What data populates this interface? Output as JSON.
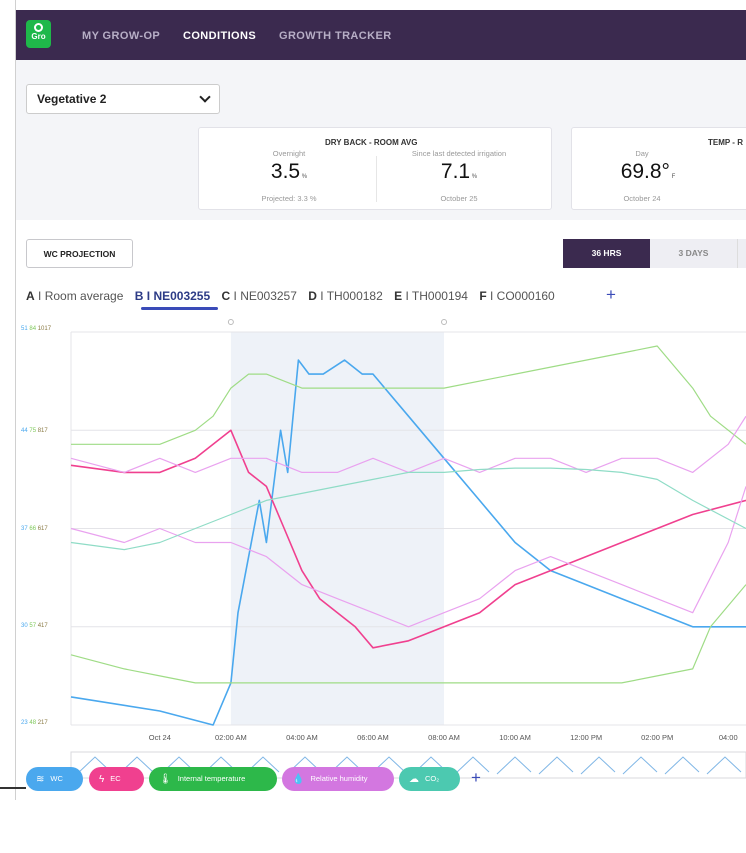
{
  "nav": {
    "logo_text": "Gro",
    "items": [
      "MY GROW-OP",
      "CONDITIONS",
      "GROWTH TRACKER"
    ],
    "active": "CONDITIONS"
  },
  "stage_select": {
    "value": "Vegetative 2"
  },
  "dryback_card": {
    "title": "DRY BACK - ROOM AVG",
    "overnight_label": "Overnight",
    "overnight_value": "3.5",
    "overnight_unit": "%",
    "projected": "Projected: 3.3 %",
    "since_label": "Since last detected irrigation",
    "since_value": "7.1",
    "since_unit": "%",
    "since_date": "October 25"
  },
  "temp_card": {
    "title": "TEMP - R",
    "day_label": "Day",
    "value": "69.8°",
    "unit": "F",
    "date": "October 24"
  },
  "wc_projection_button": "WC PROJECTION",
  "range_buttons": [
    "36 HRS",
    "3 DAYS"
  ],
  "range_active": "36 HRS",
  "sensor_tabs": [
    {
      "letter": "A",
      "label": "Room average"
    },
    {
      "letter": "B",
      "label": "NE003255"
    },
    {
      "letter": "C",
      "label": "NE003257"
    },
    {
      "letter": "D",
      "label": "TH000182"
    },
    {
      "letter": "E",
      "label": "TH000194"
    },
    {
      "letter": "F",
      "label": "CO000160"
    }
  ],
  "sensor_tab_selected": "B",
  "sensor_tabs_add": "+",
  "colors": {
    "topbar": "#3b2a4f",
    "accent": "#3a4bb8",
    "wc": "#4aa8ee",
    "ec": "#f0408f",
    "temp": "#2db84a",
    "humidity": "#d377e0",
    "co2": "#4cc9b0"
  },
  "chart_data": {
    "type": "line",
    "y_axes": [
      {
        "ticks": [
          "51",
          "44",
          "37",
          "30",
          "23"
        ],
        "range": [
          23,
          51
        ]
      },
      {
        "ticks": [
          "84",
          "75",
          "66",
          "57",
          "48"
        ],
        "range": [
          48,
          84
        ]
      },
      {
        "ticks": [
          "1017",
          "817",
          "617",
          "417",
          "217"
        ],
        "range": [
          217,
          1017
        ]
      }
    ],
    "x_tick_labels": [
      "Oct 24",
      "02:00 AM",
      "04:00 AM",
      "06:00 AM",
      "08:00 AM",
      "10:00 AM",
      "12:00 PM",
      "02:00 PM",
      "04:00"
    ],
    "x_range_hours": [
      -2.5,
      16.5
    ],
    "highlight_hours": [
      2,
      8
    ],
    "grid": true,
    "series": [
      {
        "color": "#4aa8ee",
        "x": [
          -2.5,
          0,
          1.5,
          2,
          2.2,
          2.8,
          3,
          3.4,
          3.6,
          3.9,
          4.2,
          4.6,
          5.2,
          5.7,
          6,
          7,
          8,
          9,
          10,
          11,
          12,
          13,
          14,
          15,
          16.5
        ],
        "y": [
          25,
          24,
          23,
          26,
          31,
          39,
          36,
          44,
          41,
          49,
          48,
          48,
          49,
          48,
          48,
          45,
          42,
          39,
          36,
          34,
          33,
          32,
          31,
          30,
          30
        ]
      },
      {
        "color": "#f0408f",
        "x": [
          -2.5,
          -1,
          0,
          1,
          1.5,
          2,
          2.5,
          3,
          3.5,
          4,
          4.5,
          5,
          5.5,
          6,
          7,
          8,
          9,
          10,
          11,
          12,
          13,
          14,
          15,
          16.5
        ],
        "y": [
          41.5,
          41,
          41,
          42,
          43,
          44,
          41,
          40,
          37,
          34,
          32,
          31,
          30,
          28.5,
          29,
          30,
          31,
          33,
          34,
          35,
          36,
          37,
          38,
          39
        ]
      },
      {
        "color": "#9fdc86",
        "x": [
          -2.5,
          -1,
          0,
          1,
          1.5,
          2,
          2.5,
          3,
          4,
          5,
          6,
          8,
          10,
          12,
          13,
          14,
          15,
          15.5,
          16.5
        ],
        "y": [
          43,
          43,
          43,
          44,
          45,
          47,
          48,
          48,
          47,
          47,
          47,
          47,
          48,
          49,
          49.5,
          50,
          47,
          45,
          43
        ]
      },
      {
        "color": "#9fdc86",
        "x": [
          -2.5,
          -1,
          0,
          1,
          2,
          3,
          4,
          6,
          8,
          10,
          12,
          13,
          14,
          15,
          15.5,
          16.5
        ],
        "y": [
          28,
          27,
          26.5,
          26,
          26,
          26,
          26,
          26,
          26,
          26,
          26,
          26,
          26.5,
          27,
          30,
          33
        ]
      },
      {
        "color": "#e9a2ef",
        "x": [
          -2.5,
          -1,
          0,
          1,
          2,
          3,
          4,
          5,
          6,
          7,
          8,
          9,
          10,
          11,
          12,
          13,
          14,
          15,
          16,
          16.5
        ],
        "y": [
          42,
          41,
          42,
          41,
          42,
          42,
          41,
          41,
          42,
          41,
          42,
          41,
          42,
          42,
          41,
          42,
          42,
          41,
          43,
          45
        ]
      },
      {
        "color": "#e9a2ef",
        "x": [
          -2.5,
          -1,
          0,
          1,
          2,
          3,
          4,
          5,
          6,
          7,
          8,
          9,
          10,
          11,
          12,
          13,
          14,
          15,
          16,
          16.5
        ],
        "y": [
          37,
          36,
          37,
          36,
          36,
          35,
          33,
          32,
          31,
          30,
          31,
          32,
          34,
          35,
          34,
          33,
          32,
          31,
          36,
          40
        ]
      },
      {
        "color": "#8fdcc6",
        "x": [
          -2.5,
          -1,
          0,
          1,
          2,
          3,
          4,
          5,
          6,
          7,
          8,
          9,
          10,
          11,
          12,
          13,
          14,
          15,
          16.5
        ],
        "y": [
          36,
          35.5,
          36,
          37,
          38,
          39,
          39.5,
          40,
          40.5,
          41,
          41,
          41.2,
          41.3,
          41.3,
          41.2,
          41,
          40.5,
          39,
          37
        ]
      }
    ]
  },
  "series_pills": [
    {
      "label": "WC",
      "icon": "waves-icon"
    },
    {
      "label": "EC",
      "icon": "bolt-icon"
    },
    {
      "label": "Internal temperature",
      "icon": "thermometer-icon"
    },
    {
      "label": "Relative humidity",
      "icon": "droplet-icon"
    },
    {
      "label": "CO₂",
      "icon": "cloud-icon"
    }
  ],
  "series_pills_add": "+"
}
